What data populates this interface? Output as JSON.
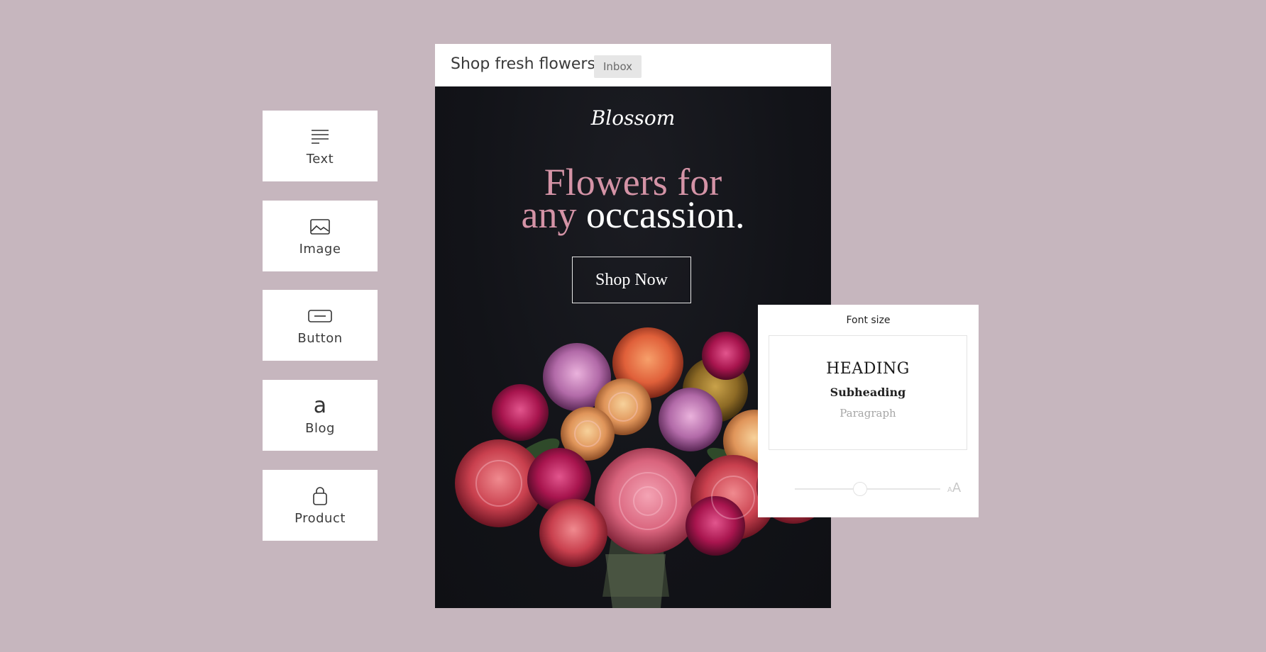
{
  "blocks": [
    {
      "label": "Text",
      "icon": "text-lines-icon"
    },
    {
      "label": "Image",
      "icon": "image-icon"
    },
    {
      "label": "Button",
      "icon": "button-icon"
    },
    {
      "label": "Blog",
      "icon": "blog-a-glyph",
      "glyph": "a"
    },
    {
      "label": "Product",
      "icon": "shopping-bag-icon"
    }
  ],
  "email": {
    "subject": "Shop fresh flowers",
    "badge": "Inbox",
    "brand": "Blossom",
    "headline": {
      "line1": "Flowers for",
      "line2_pink": "any",
      "line2_white": "occassion."
    },
    "cta": "Shop Now",
    "colors": {
      "accent_pink": "#d493a6",
      "background": "#121318"
    }
  },
  "font_panel": {
    "title": "Font size",
    "heading_sample": "HEADING",
    "subheading_sample": "Subheading",
    "paragraph_sample": "Paragraph",
    "size_icon_small": "A",
    "size_icon_large": "A",
    "slider_value": 0.45
  },
  "colors": {
    "page_background": "#c6b6be"
  }
}
